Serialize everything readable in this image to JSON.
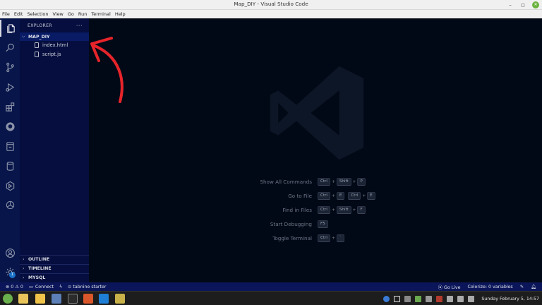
{
  "window": {
    "title": "Map_DIY - Visual Studio Code"
  },
  "menu": [
    "File",
    "Edit",
    "Selection",
    "View",
    "Go",
    "Run",
    "Terminal",
    "Help"
  ],
  "activity_bar": {
    "icons": [
      "files-icon",
      "search-icon",
      "source-control-icon",
      "run-debug-icon",
      "extensions-icon",
      "github-icon",
      "remote-explorer-icon",
      "database-icon",
      "hexagon-icon",
      "openai-icon"
    ],
    "bottom_icons": [
      "account-icon",
      "gear-icon"
    ],
    "settings_badge": "1"
  },
  "explorer": {
    "header": "EXPLORER",
    "more": "···",
    "folder": "MAP_DIY",
    "files": [
      "index.html",
      "script.js"
    ],
    "sections": [
      "OUTLINE",
      "TIMELINE",
      "MYSQL"
    ]
  },
  "editor": {
    "shortcuts": [
      {
        "label": "Show All Commands",
        "keys": [
          [
            "Ctrl",
            "Shift",
            "P"
          ]
        ]
      },
      {
        "label": "Go to File",
        "keys": [
          [
            "Ctrl",
            "E"
          ],
          [
            "Ctrl",
            "E"
          ]
        ]
      },
      {
        "label": "Find in Files",
        "keys": [
          [
            "Ctrl",
            "Shift",
            "F"
          ]
        ]
      },
      {
        "label": "Start Debugging",
        "keys": [
          [
            "F5"
          ]
        ]
      },
      {
        "label": "Toggle Terminal",
        "keys": [
          [
            "Ctrl",
            "`"
          ]
        ]
      }
    ]
  },
  "status_bar": {
    "problems": "⊗ 0 ⚠ 0",
    "connect": "Connect",
    "tabnine": "tabnine starter",
    "go_live": "Go Live",
    "colorize": "Colorize: 0 variables"
  },
  "taskbar": {
    "clock": "Sunday February 5, 14:57"
  }
}
